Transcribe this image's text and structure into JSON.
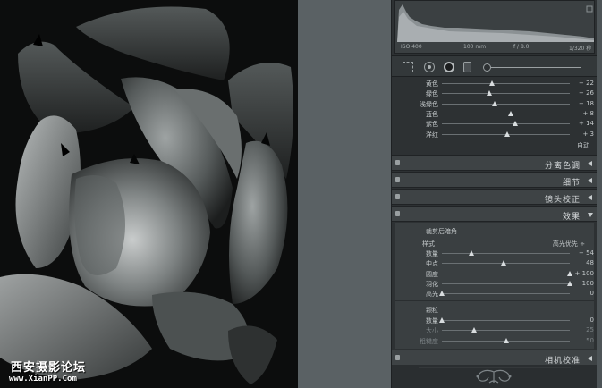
{
  "photo": {
    "description_icon": "succulent-photo"
  },
  "watermark": {
    "line1": "西安摄影论坛",
    "line2": "www.XianPP.Com"
  },
  "histogram": {
    "iso": "ISO 400",
    "focal": "100 mm",
    "aperture": "f / 8.0",
    "shutter": "1/320 秒"
  },
  "tools": [
    "crop-overlay-icon",
    "spot-removal-icon",
    "red-eye-icon",
    "adjustment-brush-icon",
    "graduated-filter-slider"
  ],
  "hsl": {
    "rows": [
      {
        "label": "黄色",
        "value": "− 22",
        "pos": 0.39
      },
      {
        "label": "绿色",
        "value": "− 26",
        "pos": 0.37
      },
      {
        "label": "浅绿色",
        "value": "− 18",
        "pos": 0.41
      },
      {
        "label": "蓝色",
        "value": "+ 8",
        "pos": 0.54
      },
      {
        "label": "紫色",
        "value": "+ 14",
        "pos": 0.57
      },
      {
        "label": "洋红",
        "value": "+ 3",
        "pos": 0.51
      }
    ],
    "auto_label": "自动"
  },
  "sections": {
    "split_toning": "分离色调",
    "detail": "细节",
    "lens": "镜头校正",
    "effects": "效果",
    "camera": "相机校准"
  },
  "effects": {
    "vignette_title": "裁剪后暗角",
    "style_label": "样式",
    "style_value": "高光优先 ÷",
    "vignette_rows": [
      {
        "label": "数量",
        "value": "− 54",
        "pos": 0.23,
        "dim": false
      },
      {
        "label": "中点",
        "value": "48",
        "pos": 0.48,
        "dim": false
      },
      {
        "label": "圆度",
        "value": "+ 100",
        "pos": 1.0,
        "dim": false
      },
      {
        "label": "羽化",
        "value": "100",
        "pos": 1.0,
        "dim": false
      },
      {
        "label": "高光",
        "value": "0",
        "pos": 0.0,
        "dim": false
      }
    ],
    "grain_title": "颗粒",
    "grain_rows": [
      {
        "label": "数量",
        "value": "0",
        "pos": 0.0,
        "dim": false
      },
      {
        "label": "大小",
        "value": "25",
        "pos": 0.25,
        "dim": true
      },
      {
        "label": "粗糙度",
        "value": "50",
        "pos": 0.5,
        "dim": true
      }
    ]
  }
}
